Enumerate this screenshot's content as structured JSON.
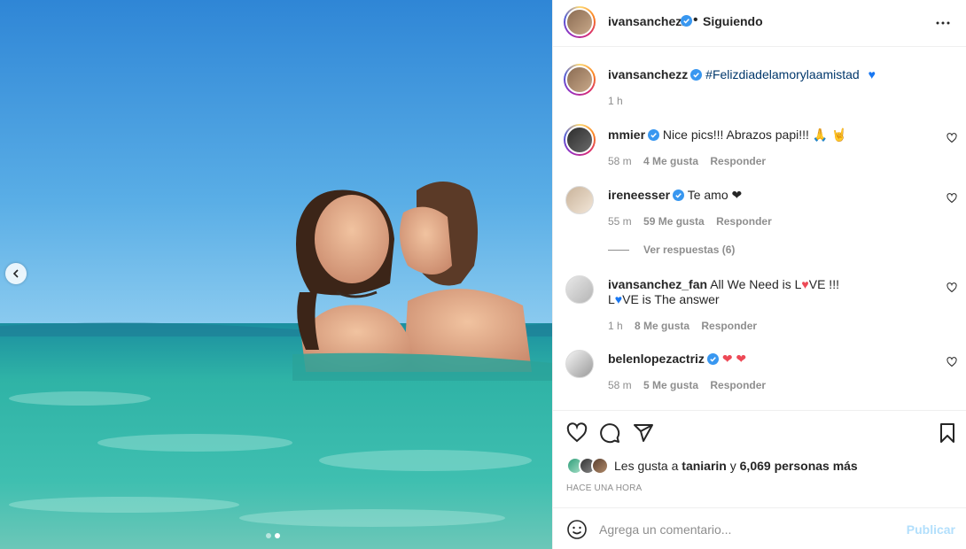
{
  "colors": {
    "verified": "#3897f0",
    "link": "#00376b",
    "muted": "#8e8e8e",
    "publish": "#b2dffc",
    "sky_top": "#2f86d6",
    "sea": "#2fb3a6"
  },
  "post": {
    "author": "ivansanchezz",
    "follow_status": "Siguiendo",
    "caption_hashtag": "#Felizdiadelamorylaamistad",
    "caption_emoji": "💙",
    "caption_time": "1 h",
    "carousel": {
      "slides": 2,
      "active_index": 1
    }
  },
  "comments": [
    {
      "user": "mmier",
      "verified": true,
      "text": "Nice pics!!! Abrazos papi!!! 🙏 🤘",
      "time": "58 m",
      "likes": "4 Me gusta",
      "reply": "Responder"
    },
    {
      "user": "ireneesser",
      "verified": true,
      "text": "Te amo ❤",
      "time": "55 m",
      "likes": "59 Me gusta",
      "reply": "Responder",
      "view_replies": "Ver respuestas (6)"
    },
    {
      "user": "ivansanchez_fan",
      "verified": false,
      "text_line1_a": "All We Need is L",
      "text_line1_b": "VE !!!",
      "text_line2_a": "L",
      "text_line2_b": "VE is The answer",
      "time": "1 h",
      "likes": "8 Me gusta",
      "reply": "Responder"
    },
    {
      "user": "belenlopezactriz",
      "verified": true,
      "text": "❤ ❤",
      "time": "58 m",
      "likes": "5 Me gusta",
      "reply": "Responder"
    }
  ],
  "actions": {
    "liked_by_prefix": "Les gusta a",
    "liked_by_user": "taniarin",
    "liked_by_connector": "y",
    "liked_by_others": "6,069 personas más",
    "time_ago": "HACE UNA HORA"
  },
  "add_comment": {
    "placeholder": "Agrega un comentario...",
    "publish_label": "Publicar"
  },
  "icons": {
    "more": "more-horizontal-icon",
    "like": "heart-icon",
    "comment": "comment-icon",
    "share": "paper-plane-icon",
    "save": "bookmark-icon",
    "emoji": "smiley-icon",
    "prev": "chevron-left-icon"
  }
}
